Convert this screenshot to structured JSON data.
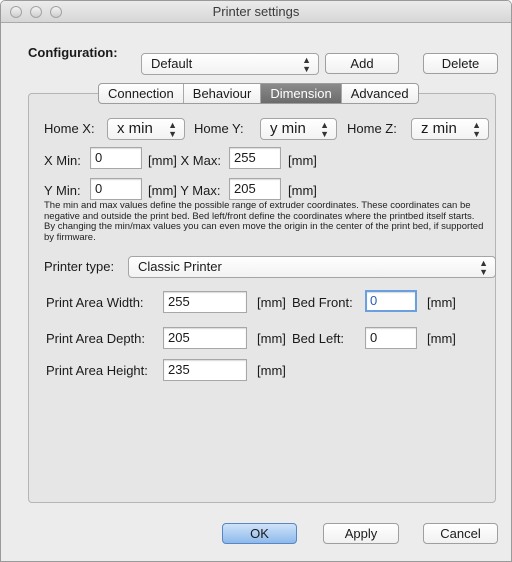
{
  "window": {
    "title": "Printer settings"
  },
  "configuration": {
    "label": "Configuration:",
    "selected": "Default",
    "add_label": "Add",
    "delete_label": "Delete"
  },
  "tabs": [
    {
      "label": "Connection",
      "active": false
    },
    {
      "label": "Behaviour",
      "active": false
    },
    {
      "label": "Dimension",
      "active": true
    },
    {
      "label": "Advanced",
      "active": false
    }
  ],
  "home": {
    "x_label": "Home X:",
    "x_value": "x min",
    "y_label": "Home Y:",
    "y_value": "y min",
    "z_label": "Home Z:",
    "z_value": "z min"
  },
  "limits": {
    "x_min_label": "X Min:",
    "x_min_value": "0",
    "x_max_label": "[mm] X Max:",
    "x_max_value": "255",
    "x_max_unit": "[mm]",
    "y_min_label": "Y Min:",
    "y_min_value": "0",
    "y_max_label": "[mm] Y Max:",
    "y_max_value": "205",
    "y_max_unit": "[mm]"
  },
  "description": "The min and max values define the possible range of extruder coordinates. These coordinates can be negative and outside the print bed. Bed left/front define the coordinates where the printbed itself starts. By changing the min/max values you can even move the origin in the center of the print bed, if supported by firmware.",
  "printer_type": {
    "label": "Printer type:",
    "selected": "Classic Printer"
  },
  "print_area": {
    "width_label": "Print Area Width:",
    "width_value": "255",
    "width_unit": "[mm]",
    "depth_label": "Print Area Depth:",
    "depth_value": "205",
    "depth_unit": "[mm]",
    "height_label": "Print Area Height:",
    "height_value": "235",
    "height_unit": "[mm]"
  },
  "bed": {
    "front_label": "Bed Front:",
    "front_value": "0",
    "front_unit": "[mm]",
    "left_label": "Bed Left:",
    "left_value": "0",
    "left_unit": "[mm]"
  },
  "footer": {
    "ok_label": "OK",
    "apply_label": "Apply",
    "cancel_label": "Cancel"
  }
}
